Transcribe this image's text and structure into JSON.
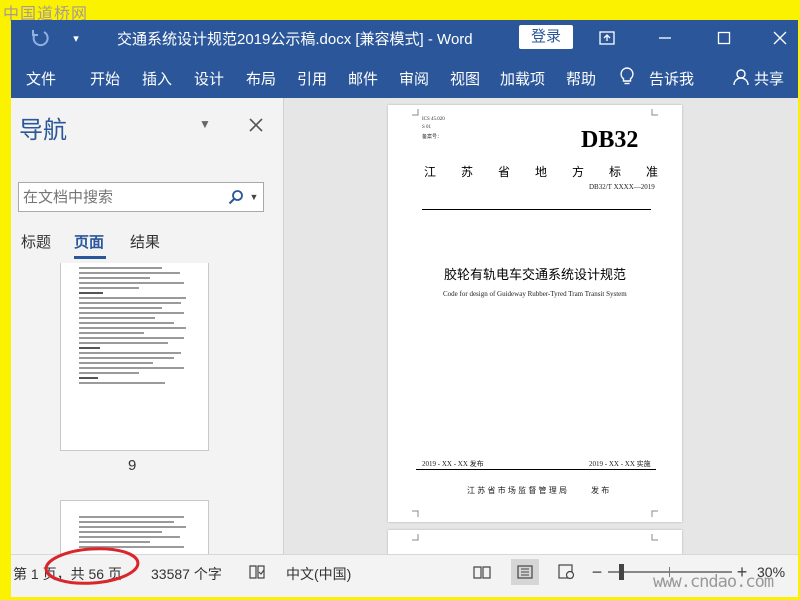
{
  "watermark_top": "中国道桥网",
  "watermark_bottom": "www.cndao.com",
  "window": {
    "title": "交通系统设计规范2019公示稿.docx [兼容模式]  -  Word",
    "login_label": "登录"
  },
  "ribbon": {
    "tabs": [
      "文件",
      "开始",
      "插入",
      "设计",
      "布局",
      "引用",
      "邮件",
      "审阅",
      "视图",
      "加载项",
      "帮助"
    ],
    "tell_me": "告诉我",
    "share": "共享"
  },
  "nav": {
    "title": "导航",
    "search_placeholder": "在文档中搜索",
    "tabs": [
      "标题",
      "页面",
      "结果"
    ],
    "active_tab": "页面",
    "thumb_page_number": "9"
  },
  "document": {
    "meta_lines": [
      "ICS 45.020",
      "S 01",
      "备案号："
    ],
    "code": "DB32",
    "region": [
      "江",
      "苏",
      "省",
      "地",
      "方",
      "标",
      "准"
    ],
    "std_number": "DB32/T XXXX—2019",
    "title_cn": "胶轮有轨电车交通系统设计规范",
    "title_en": "Code for design of Guideway Rubber-Tyred Tram Transit System",
    "publish_date": "2019 - XX - XX 发布",
    "implement_date": "2019 - XX - XX 实施",
    "issuer": "江 苏 省 市 场 监 督 管 理 局",
    "issue_word": "发 布"
  },
  "status": {
    "page_info": "第 1 页，共 56 页",
    "word_count": "33587 个字",
    "language": "中文(中国)",
    "zoom": "30%"
  },
  "colors": {
    "word_blue": "#2b579a",
    "highlight_yellow": "#fbf200",
    "annotation_red": "#d9262b"
  }
}
